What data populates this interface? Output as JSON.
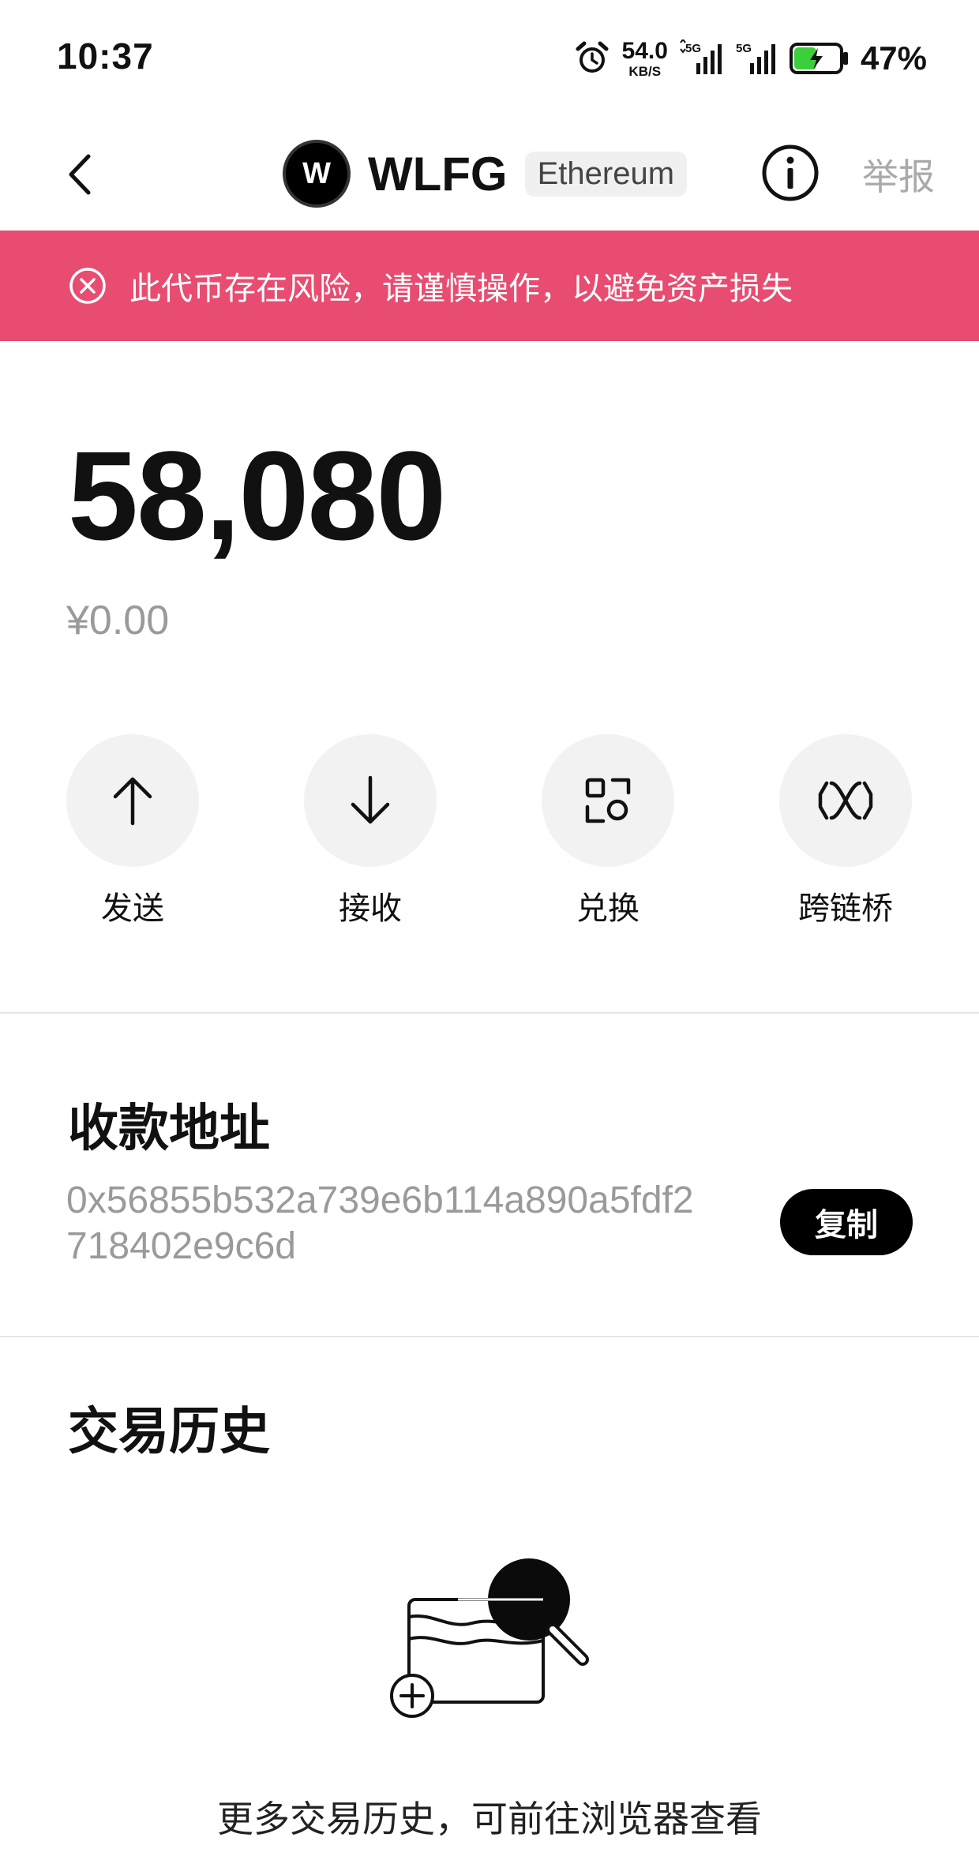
{
  "status_bar": {
    "time": "10:37",
    "net_speed_value": "54.0",
    "net_speed_unit": "KB/S",
    "battery_percent": "47%"
  },
  "header": {
    "token_logo_letter": "W",
    "token_symbol": "WLFG",
    "chain": "Ethereum",
    "report_label": "举报"
  },
  "warning": {
    "text": "此代币存在风险，请谨慎操作，以避免资产损失",
    "color": "#e84c70"
  },
  "balance": {
    "amount": "58,080",
    "fiat_value": "¥0.00"
  },
  "actions": [
    {
      "label": "发送",
      "icon": "arrow-up-icon"
    },
    {
      "label": "接收",
      "icon": "arrow-down-icon"
    },
    {
      "label": "兑换",
      "icon": "swap-icon"
    },
    {
      "label": "跨链桥",
      "icon": "bridge-icon"
    }
  ],
  "receive_address": {
    "title": "收款地址",
    "address": "0x56855b532a739e6b114a890a5fdf2718402e9c6d",
    "copy_label": "复制"
  },
  "history": {
    "title": "交易历史",
    "empty_text": "更多交易历史，可前往浏览器查看"
  }
}
